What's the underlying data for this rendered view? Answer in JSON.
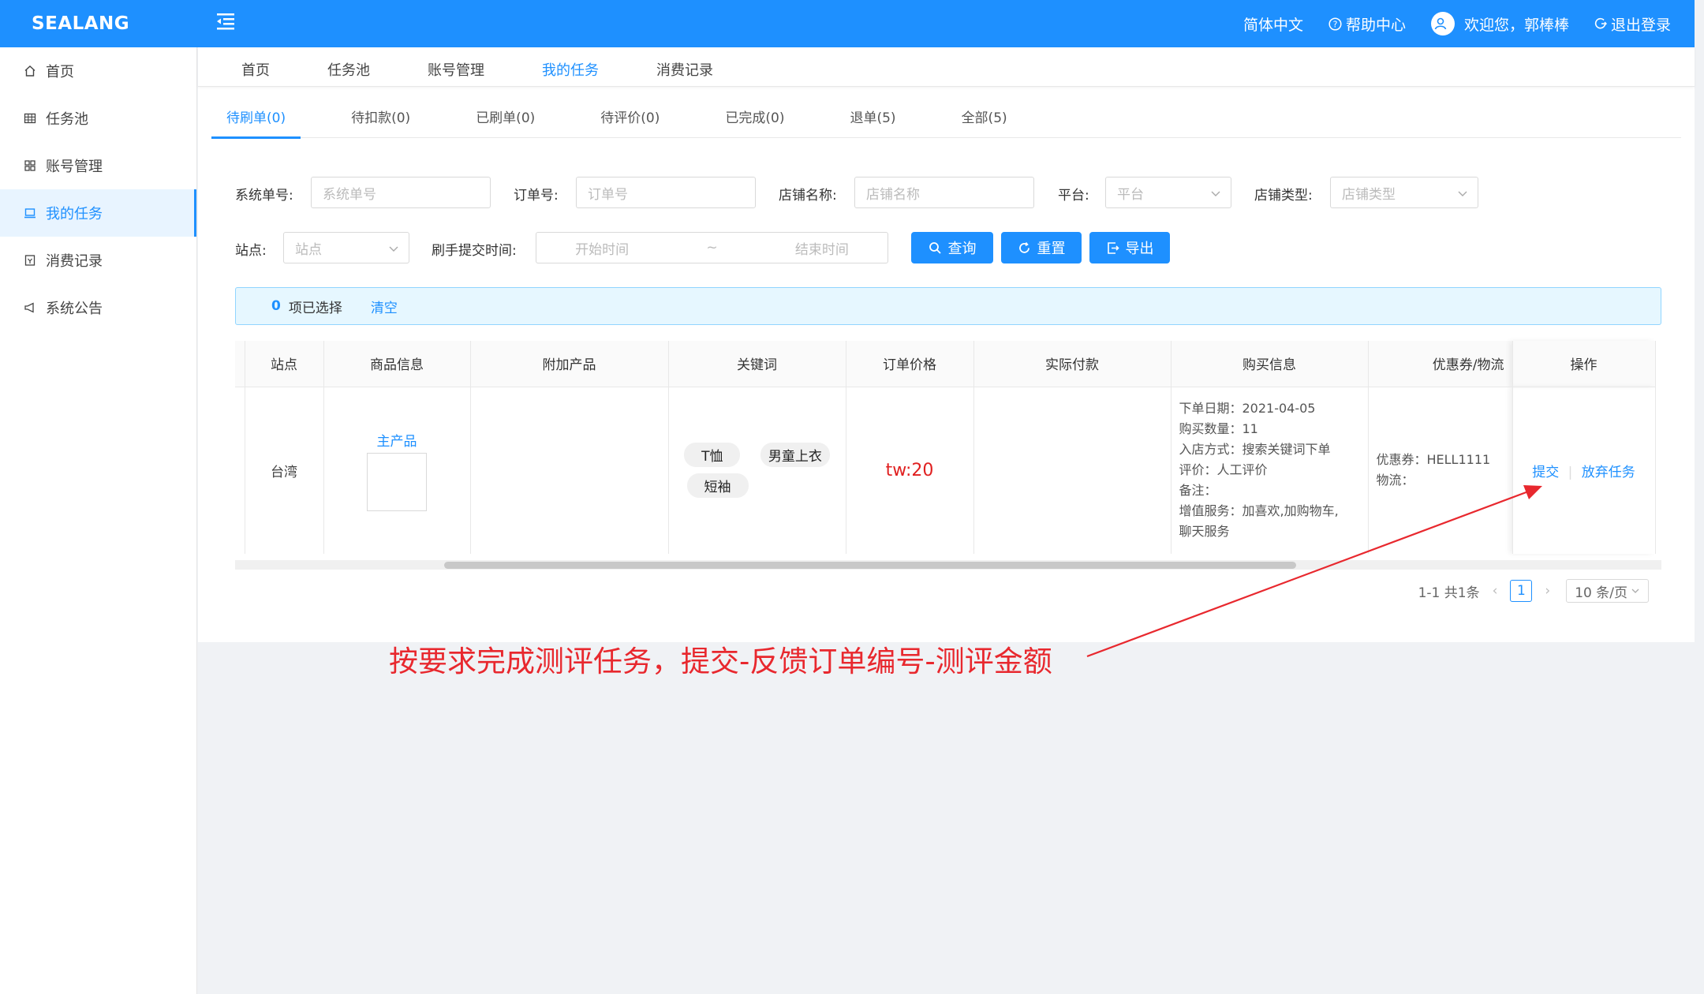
{
  "app": {
    "logo": "SEALANG"
  },
  "header": {
    "language": "简体中文",
    "help": "帮助中心",
    "welcome": "欢迎您，郭棒棒",
    "logout": "退出登录"
  },
  "sidebar": {
    "items": [
      {
        "label": "首页",
        "icon": "home-icon"
      },
      {
        "label": "任务池",
        "icon": "grid-icon"
      },
      {
        "label": "账号管理",
        "icon": "apps-icon"
      },
      {
        "label": "我的任务",
        "icon": "laptop-icon",
        "active": true
      },
      {
        "label": "消费记录",
        "icon": "receipt-icon"
      },
      {
        "label": "系统公告",
        "icon": "megaphone-icon"
      }
    ]
  },
  "nav_tabs": [
    "首页",
    "任务池",
    "账号管理",
    "我的任务",
    "消费记录"
  ],
  "status_tabs": [
    "待刷单(0)",
    "待扣款(0)",
    "已刷单(0)",
    "待评价(0)",
    "已完成(0)",
    "退单(5)",
    "全部(5)"
  ],
  "filters": {
    "system_no": {
      "label": "系统单号:",
      "placeholder": "系统单号"
    },
    "order_no": {
      "label": "订单号:",
      "placeholder": "订单号"
    },
    "shop_name": {
      "label": "店铺名称:",
      "placeholder": "店铺名称"
    },
    "platform": {
      "label": "平台:",
      "placeholder": "平台"
    },
    "shop_type": {
      "label": "店铺类型:",
      "placeholder": "店铺类型"
    },
    "site": {
      "label": "站点:",
      "placeholder": "站点"
    },
    "submit_time": {
      "label": "刷手提交时间:",
      "start": "开始时间",
      "sep": "~",
      "end": "结束时间"
    },
    "btn_query": "查询",
    "btn_reset": "重置",
    "btn_export": "导出"
  },
  "selection": {
    "count": "0",
    "text": "项已选择",
    "clear": "清空"
  },
  "table": {
    "headers": [
      "站点",
      "商品信息",
      "附加产品",
      "关键词",
      "订单价格",
      "实际付款",
      "购买信息",
      "优惠券/物流",
      "操作"
    ],
    "row": {
      "site": "台湾",
      "product_label": "主产品",
      "keywords": [
        "T恤",
        "男童上衣",
        "短袖"
      ],
      "price": "tw:20",
      "buy_info": [
        "下单日期：2021-04-05",
        "购买数量：11",
        "入店方式：搜索关键词下单",
        "评价：人工评价",
        "备注：",
        "增值服务：加喜欢,加购物车,",
        "聊天服务"
      ],
      "coupon": "优惠券：HELL1111",
      "logistics": "物流：",
      "action_submit": "提交",
      "action_abandon": "放弃任务"
    }
  },
  "pagination": {
    "summary": "1-1 共1条",
    "current": "1",
    "page_size": "10 条/页"
  },
  "annotation": {
    "text": "按要求完成测评任务，提交-反馈订单编号-测评金额",
    "color": "#e8282e"
  },
  "colors": {
    "primary": "#1e90ff",
    "price": "#e02020"
  }
}
